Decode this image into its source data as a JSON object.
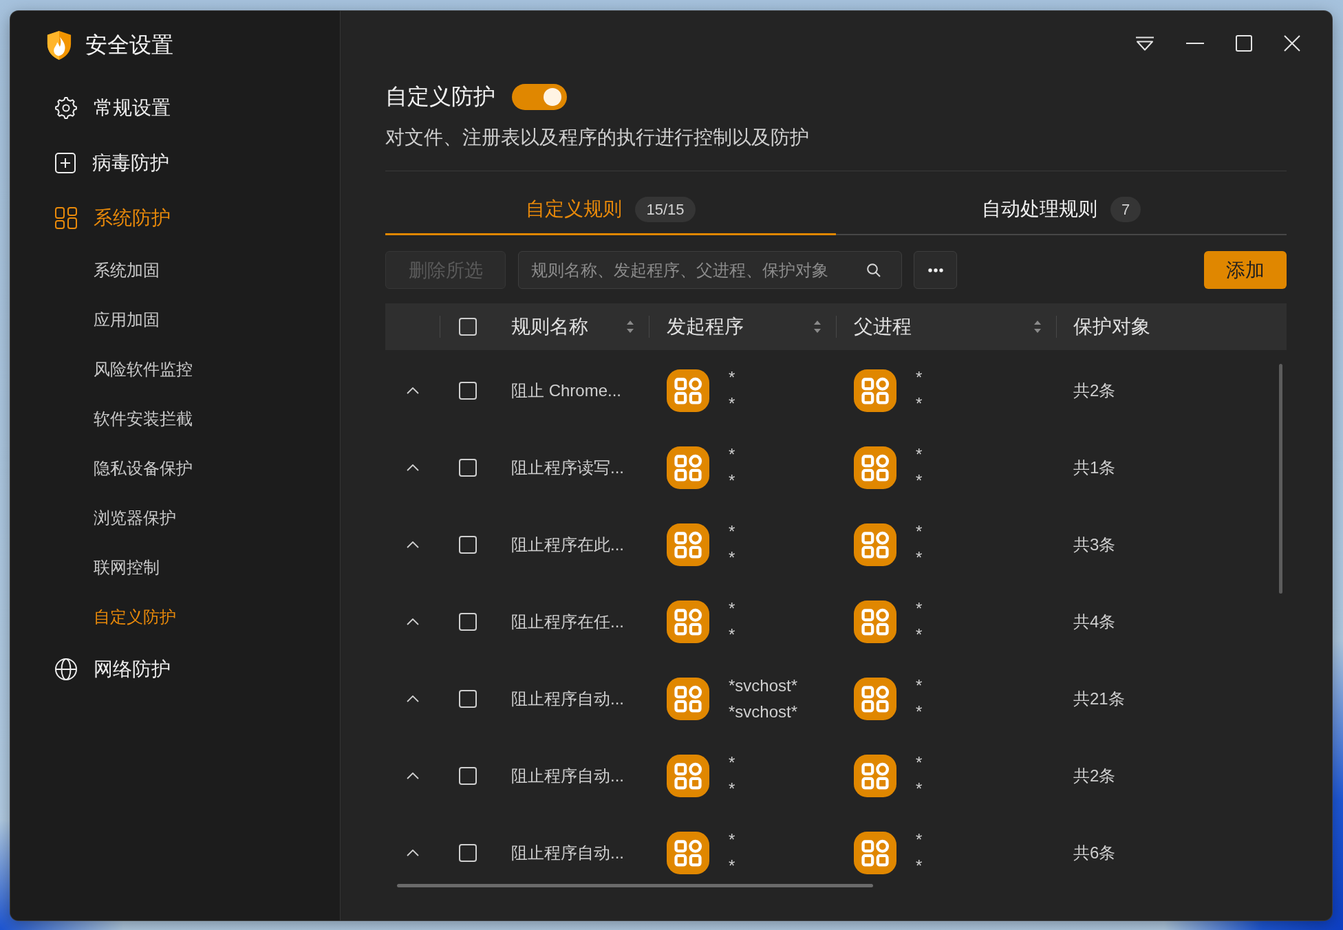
{
  "app": {
    "title": "安全设置"
  },
  "sidebar": {
    "items": [
      {
        "label": "常规设置",
        "selected": false
      },
      {
        "label": "病毒防护",
        "selected": false
      },
      {
        "label": "系统防护",
        "selected": true,
        "children": [
          {
            "label": "系统加固",
            "selected": false
          },
          {
            "label": "应用加固",
            "selected": false
          },
          {
            "label": "风险软件监控",
            "selected": false
          },
          {
            "label": "软件安装拦截",
            "selected": false
          },
          {
            "label": "隐私设备保护",
            "selected": false
          },
          {
            "label": "浏览器保护",
            "selected": false
          },
          {
            "label": "联网控制",
            "selected": false
          },
          {
            "label": "自定义防护",
            "selected": true
          }
        ]
      },
      {
        "label": "网络防护",
        "selected": false
      }
    ]
  },
  "header": {
    "title": "自定义防护",
    "toggle": {
      "on": true
    },
    "description": "对文件、注册表以及程序的执行进行控制以及防护"
  },
  "tabs": [
    {
      "label": "自定义规则",
      "count": "15/15",
      "selected": true
    },
    {
      "label": "自动处理规则",
      "count": "7",
      "selected": false
    }
  ],
  "toolbar": {
    "delete_button": {
      "label": "删除所选",
      "disabled": true
    },
    "search": {
      "placeholder": "规则名称、发起程序、父进程、保护对象"
    },
    "add_button": {
      "label": "添加"
    }
  },
  "table": {
    "select_all": {
      "checked": false
    },
    "columns": [
      {
        "label": "规则名称",
        "sortable": true
      },
      {
        "label": "发起程序",
        "sortable": true
      },
      {
        "label": "父进程",
        "sortable": true
      },
      {
        "label": "保护对象",
        "sortable": false
      }
    ],
    "rows": [
      {
        "checked": false,
        "rule_name": "阻止 Chrome...",
        "initiator": [
          "*",
          "*"
        ],
        "parent_process": [
          "*",
          "*"
        ],
        "protected_objects": "共2条"
      },
      {
        "checked": false,
        "rule_name": "阻止程序读写...",
        "initiator": [
          "*",
          "*"
        ],
        "parent_process": [
          "*",
          "*"
        ],
        "protected_objects": "共1条"
      },
      {
        "checked": false,
        "rule_name": "阻止程序在此...",
        "initiator": [
          "*",
          "*"
        ],
        "parent_process": [
          "*",
          "*"
        ],
        "protected_objects": "共3条"
      },
      {
        "checked": false,
        "rule_name": "阻止程序在任...",
        "initiator": [
          "*",
          "*"
        ],
        "parent_process": [
          "*",
          "*"
        ],
        "protected_objects": "共4条"
      },
      {
        "checked": false,
        "rule_name": "阻止程序自动...",
        "initiator": [
          "*svchost*",
          "*svchost*"
        ],
        "parent_process": [
          "*",
          "*"
        ],
        "protected_objects": "共21条"
      },
      {
        "checked": false,
        "rule_name": "阻止程序自动...",
        "initiator": [
          "*",
          "*"
        ],
        "parent_process": [
          "*",
          "*"
        ],
        "protected_objects": "共2条"
      },
      {
        "checked": false,
        "rule_name": "阻止程序自动...",
        "initiator": [
          "*",
          "*"
        ],
        "parent_process": [
          "*",
          "*"
        ],
        "protected_objects": "共6条"
      }
    ]
  }
}
